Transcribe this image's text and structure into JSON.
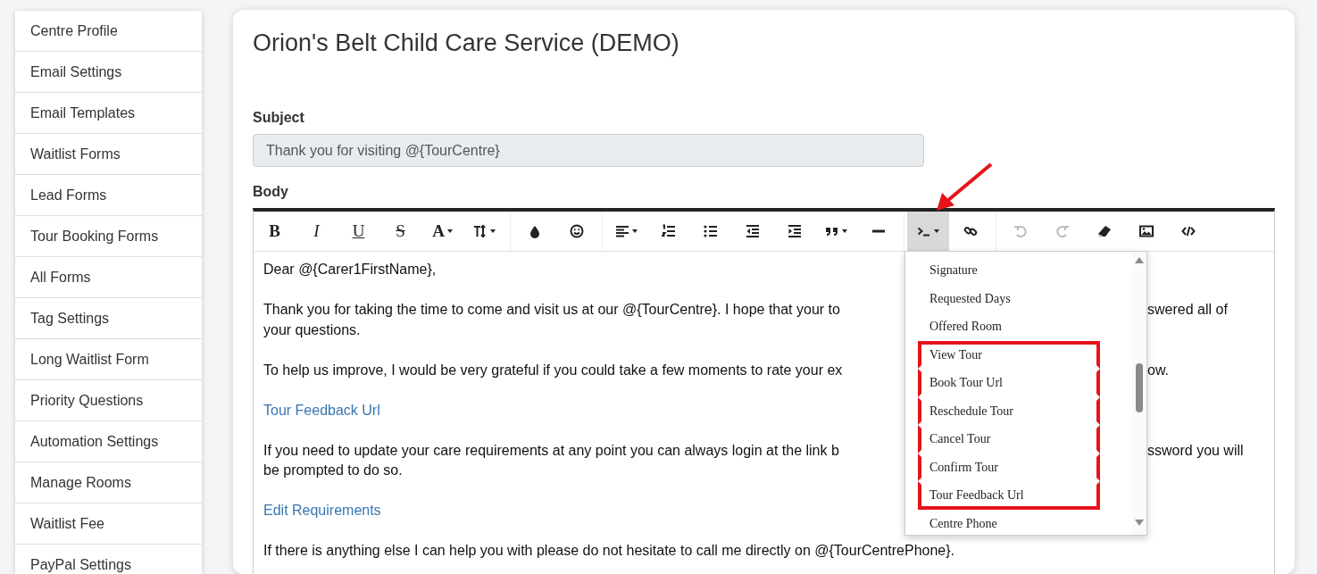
{
  "sidebar": {
    "items": [
      {
        "label": "Centre Profile",
        "selected": false
      },
      {
        "label": "Email Settings",
        "selected": false
      },
      {
        "label": "Email Templates",
        "selected": false
      },
      {
        "label": "Waitlist Forms",
        "selected": false
      },
      {
        "label": "Lead Forms",
        "selected": false
      },
      {
        "label": "Tour Booking Forms",
        "selected": false
      },
      {
        "label": "All Forms",
        "selected": false
      },
      {
        "label": "Tag Settings",
        "selected": false
      },
      {
        "label": "Long Waitlist Form",
        "selected": false
      },
      {
        "label": "Priority Questions",
        "selected": false
      },
      {
        "label": "Automation Settings",
        "selected": false
      },
      {
        "label": "Manage Rooms",
        "selected": false
      },
      {
        "label": "Waitlist Fee",
        "selected": false
      },
      {
        "label": "PayPal Settings",
        "selected": false
      }
    ]
  },
  "page": {
    "title": "Orion's Belt Child Care Service (DEMO)"
  },
  "subject": {
    "label": "Subject",
    "value": "Thank you for visiting @{TourCentre}",
    "disabled": true
  },
  "body": {
    "label": "Body",
    "toolbar": [
      [
        {
          "kind": "bold",
          "label": "B",
          "dropdown": false,
          "active": false,
          "disabled": false
        },
        {
          "kind": "italic",
          "label": "I",
          "dropdown": false,
          "active": false,
          "disabled": false
        },
        {
          "kind": "underline",
          "label": "U",
          "dropdown": false,
          "active": false,
          "disabled": false
        },
        {
          "kind": "strike",
          "label": "S",
          "dropdown": false,
          "active": false,
          "disabled": false
        },
        {
          "kind": "font",
          "label": "A",
          "dropdown": true,
          "active": false,
          "disabled": false
        },
        {
          "kind": "fontsize",
          "dropdown": true,
          "active": false,
          "disabled": false
        }
      ],
      [
        {
          "kind": "color",
          "dropdown": false,
          "active": false,
          "disabled": false
        },
        {
          "kind": "emoji",
          "dropdown": false,
          "active": false,
          "disabled": false
        }
      ],
      [
        {
          "kind": "align",
          "dropdown": true,
          "active": false,
          "disabled": false
        },
        {
          "kind": "ol",
          "dropdown": false,
          "active": false,
          "disabled": false
        },
        {
          "kind": "ul",
          "dropdown": false,
          "active": false,
          "disabled": false
        },
        {
          "kind": "outdent",
          "dropdown": false,
          "active": false,
          "disabled": false
        },
        {
          "kind": "indent",
          "dropdown": false,
          "active": false,
          "disabled": false
        },
        {
          "kind": "quote",
          "dropdown": true,
          "active": false,
          "disabled": false
        },
        {
          "kind": "hr",
          "dropdown": false,
          "active": false,
          "disabled": false
        }
      ],
      [
        {
          "kind": "terminal",
          "dropdown": true,
          "active": true,
          "disabled": false
        },
        {
          "kind": "link",
          "dropdown": false,
          "active": false,
          "disabled": false
        }
      ],
      [
        {
          "kind": "undo",
          "dropdown": false,
          "active": false,
          "disabled": true
        },
        {
          "kind": "redo",
          "dropdown": false,
          "active": false,
          "disabled": true
        },
        {
          "kind": "eraser",
          "dropdown": false,
          "active": false,
          "disabled": false
        },
        {
          "kind": "image",
          "dropdown": false,
          "active": false,
          "disabled": false
        },
        {
          "kind": "code",
          "dropdown": false,
          "active": false,
          "disabled": false
        }
      ]
    ],
    "paragraphs": [
      {
        "kind": "text",
        "lines": [
          {
            "left": "Dear @{Carer1FirstName},"
          }
        ]
      },
      {
        "kind": "text",
        "lines": [
          {
            "left": "Thank you for taking the time to come and visit us at our @{TourCentre}. I hope that your to",
            "right": "swered all of"
          },
          {
            "left": "your questions."
          }
        ]
      },
      {
        "kind": "text",
        "lines": [
          {
            "left": "To help us improve, I would be very grateful if you could take a few moments to rate your ex",
            "right": "ow."
          }
        ]
      },
      {
        "kind": "link",
        "lines": [
          {
            "left": "Tour Feedback Url"
          }
        ]
      },
      {
        "kind": "text",
        "lines": [
          {
            "left": "If you need to update your care requirements at any point you can always login at the link b",
            "right": "ssword you will"
          },
          {
            "left": "be prompted to do so."
          }
        ]
      },
      {
        "kind": "link",
        "lines": [
          {
            "left": "Edit Requirements"
          }
        ]
      },
      {
        "kind": "text",
        "lines": [
          {
            "left": "If there is anything else I can help you with please do not hesitate to call me directly on @{TourCentrePhone}."
          }
        ]
      }
    ],
    "variables": {
      "items": [
        {
          "label": "Signature",
          "highlighted": false
        },
        {
          "label": "Requested Days",
          "highlighted": false
        },
        {
          "label": "Offered Room",
          "highlighted": false
        },
        {
          "label": "View Tour",
          "highlighted": true
        },
        {
          "label": "Book Tour Url",
          "highlighted": true
        },
        {
          "label": "Reschedule Tour",
          "highlighted": true
        },
        {
          "label": "Cancel Tour",
          "highlighted": true
        },
        {
          "label": "Confirm Tour",
          "highlighted": true
        },
        {
          "label": "Tour Feedback Url",
          "highlighted": true
        },
        {
          "label": "Centre Phone",
          "highlighted": false
        }
      ]
    }
  }
}
